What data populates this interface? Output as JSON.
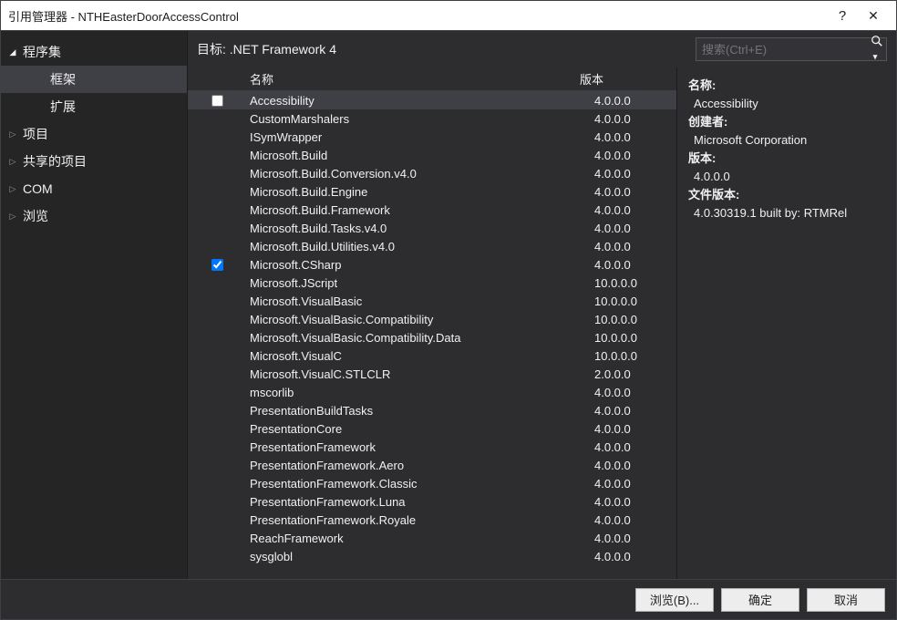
{
  "window": {
    "title": "引用管理器 - NTHEasterDoorAccessControl"
  },
  "sidebar": {
    "items": [
      {
        "label": "程序集",
        "type": "expanded"
      },
      {
        "label": "框架",
        "type": "level2 selected"
      },
      {
        "label": "扩展",
        "type": "level2"
      },
      {
        "label": "项目",
        "type": "collapsed"
      },
      {
        "label": "共享的项目",
        "type": "collapsed"
      },
      {
        "label": "COM",
        "type": "collapsed"
      },
      {
        "label": "浏览",
        "type": "collapsed"
      }
    ]
  },
  "target": "目标: .NET Framework 4",
  "search": {
    "placeholder": "搜索(Ctrl+E)"
  },
  "columns": {
    "name": "名称",
    "version": "版本"
  },
  "rows": [
    {
      "name": "Accessibility",
      "ver": "4.0.0.0",
      "checked": false,
      "selected": true,
      "showbox": true
    },
    {
      "name": "CustomMarshalers",
      "ver": "4.0.0.0"
    },
    {
      "name": "ISymWrapper",
      "ver": "4.0.0.0"
    },
    {
      "name": "Microsoft.Build",
      "ver": "4.0.0.0"
    },
    {
      "name": "Microsoft.Build.Conversion.v4.0",
      "ver": "4.0.0.0"
    },
    {
      "name": "Microsoft.Build.Engine",
      "ver": "4.0.0.0"
    },
    {
      "name": "Microsoft.Build.Framework",
      "ver": "4.0.0.0"
    },
    {
      "name": "Microsoft.Build.Tasks.v4.0",
      "ver": "4.0.0.0"
    },
    {
      "name": "Microsoft.Build.Utilities.v4.0",
      "ver": "4.0.0.0"
    },
    {
      "name": "Microsoft.CSharp",
      "ver": "4.0.0.0",
      "checked": true,
      "showbox": true
    },
    {
      "name": "Microsoft.JScript",
      "ver": "10.0.0.0"
    },
    {
      "name": "Microsoft.VisualBasic",
      "ver": "10.0.0.0"
    },
    {
      "name": "Microsoft.VisualBasic.Compatibility",
      "ver": "10.0.0.0"
    },
    {
      "name": "Microsoft.VisualBasic.Compatibility.Data",
      "ver": "10.0.0.0"
    },
    {
      "name": "Microsoft.VisualC",
      "ver": "10.0.0.0"
    },
    {
      "name": "Microsoft.VisualC.STLCLR",
      "ver": "2.0.0.0"
    },
    {
      "name": "mscorlib",
      "ver": "4.0.0.0"
    },
    {
      "name": "PresentationBuildTasks",
      "ver": "4.0.0.0"
    },
    {
      "name": "PresentationCore",
      "ver": "4.0.0.0"
    },
    {
      "name": "PresentationFramework",
      "ver": "4.0.0.0"
    },
    {
      "name": "PresentationFramework.Aero",
      "ver": "4.0.0.0"
    },
    {
      "name": "PresentationFramework.Classic",
      "ver": "4.0.0.0"
    },
    {
      "name": "PresentationFramework.Luna",
      "ver": "4.0.0.0"
    },
    {
      "name": "PresentationFramework.Royale",
      "ver": "4.0.0.0"
    },
    {
      "name": "ReachFramework",
      "ver": "4.0.0.0"
    },
    {
      "name": "sysglobl",
      "ver": "4.0.0.0"
    }
  ],
  "details": {
    "name_lbl": "名称:",
    "name": "Accessibility",
    "creator_lbl": "创建者:",
    "creator": "Microsoft Corporation",
    "version_lbl": "版本:",
    "version": "4.0.0.0",
    "filever_lbl": "文件版本:",
    "filever": "4.0.30319.1 built by: RTMRel"
  },
  "footer": {
    "browse": "浏览(B)...",
    "ok": "确定",
    "cancel": "取消"
  }
}
